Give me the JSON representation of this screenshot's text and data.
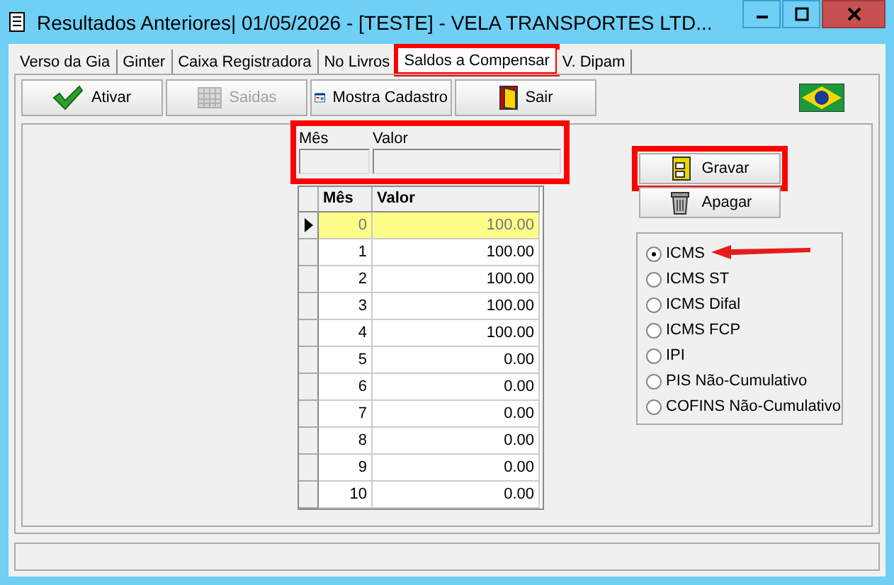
{
  "window": {
    "title": "Resultados Anteriores|  01/05/2026 - [TESTE] - VELA TRANSPORTES LTD..."
  },
  "tabs": [
    {
      "label": "Verso da Gia",
      "selected": false,
      "highlighted": false
    },
    {
      "label": "Ginter",
      "selected": false,
      "highlighted": false
    },
    {
      "label": "Caixa Registradora",
      "selected": false,
      "highlighted": false
    },
    {
      "label": "No Livros",
      "selected": false,
      "highlighted": false
    },
    {
      "label": "Saldos a Compensar",
      "selected": true,
      "highlighted": true
    },
    {
      "label": "V. Dipam",
      "selected": false,
      "highlighted": false
    }
  ],
  "toolbar": [
    {
      "label": "Ativar",
      "disabled": false
    },
    {
      "label": "Saidas",
      "disabled": true
    },
    {
      "label": "Mostra Cadastro",
      "disabled": false
    },
    {
      "label": "Sair",
      "disabled": false
    }
  ],
  "form": {
    "highlighted": true,
    "fields": [
      {
        "label": "Mês"
      },
      {
        "label": "Valor"
      }
    ]
  },
  "table": {
    "columns": [
      "Mês",
      "Valor"
    ],
    "rows": [
      {
        "mes": "0",
        "valor": "100.00",
        "selected": true
      },
      {
        "mes": "1",
        "valor": "100.00",
        "selected": false
      },
      {
        "mes": "2",
        "valor": "100.00",
        "selected": false
      },
      {
        "mes": "3",
        "valor": "100.00",
        "selected": false
      },
      {
        "mes": "4",
        "valor": "100.00",
        "selected": false
      },
      {
        "mes": "5",
        "valor": "0.00",
        "selected": false
      },
      {
        "mes": "6",
        "valor": "0.00",
        "selected": false
      },
      {
        "mes": "7",
        "valor": "0.00",
        "selected": false
      },
      {
        "mes": "8",
        "valor": "0.00",
        "selected": false
      },
      {
        "mes": "9",
        "valor": "0.00",
        "selected": false
      },
      {
        "mes": "10",
        "valor": "0.00",
        "selected": false
      }
    ]
  },
  "actions": [
    {
      "label": "Gravar",
      "highlighted": true
    },
    {
      "label": "Apagar",
      "highlighted": false
    }
  ],
  "taxes": [
    {
      "label": "ICMS",
      "selected": true
    },
    {
      "label": "ICMS ST",
      "selected": false
    },
    {
      "label": "ICMS Difal",
      "selected": false
    },
    {
      "label": "ICMS FCP",
      "selected": false
    },
    {
      "label": "IPI",
      "selected": false
    },
    {
      "label": "PIS Não-Cumulativo",
      "selected": false
    },
    {
      "label": "COFINS Não-Cumulativo",
      "selected": false
    }
  ]
}
